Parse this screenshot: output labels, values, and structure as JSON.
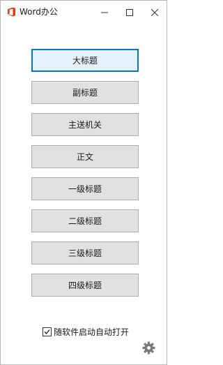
{
  "window": {
    "title": "Word办公",
    "controls": {
      "minimize": "—",
      "maximize": "☐",
      "close": "✕"
    }
  },
  "buttons": [
    {
      "label": "大标题",
      "focused": true
    },
    {
      "label": "副标题"
    },
    {
      "label": "主送机关"
    },
    {
      "label": "正文"
    },
    {
      "label": "一级标题"
    },
    {
      "label": "二级标题"
    },
    {
      "label": "三级标题"
    },
    {
      "label": "四级标题"
    }
  ],
  "autostart": {
    "label": "随软件启动自动打开",
    "checked": true
  },
  "colors": {
    "accent": "#0078d7",
    "button_bg": "#e1e1e1",
    "office_red": "#e23d16",
    "gear": "#7a7a7a"
  },
  "icons": {
    "app": "office-logo-icon",
    "settings": "gear-icon"
  }
}
